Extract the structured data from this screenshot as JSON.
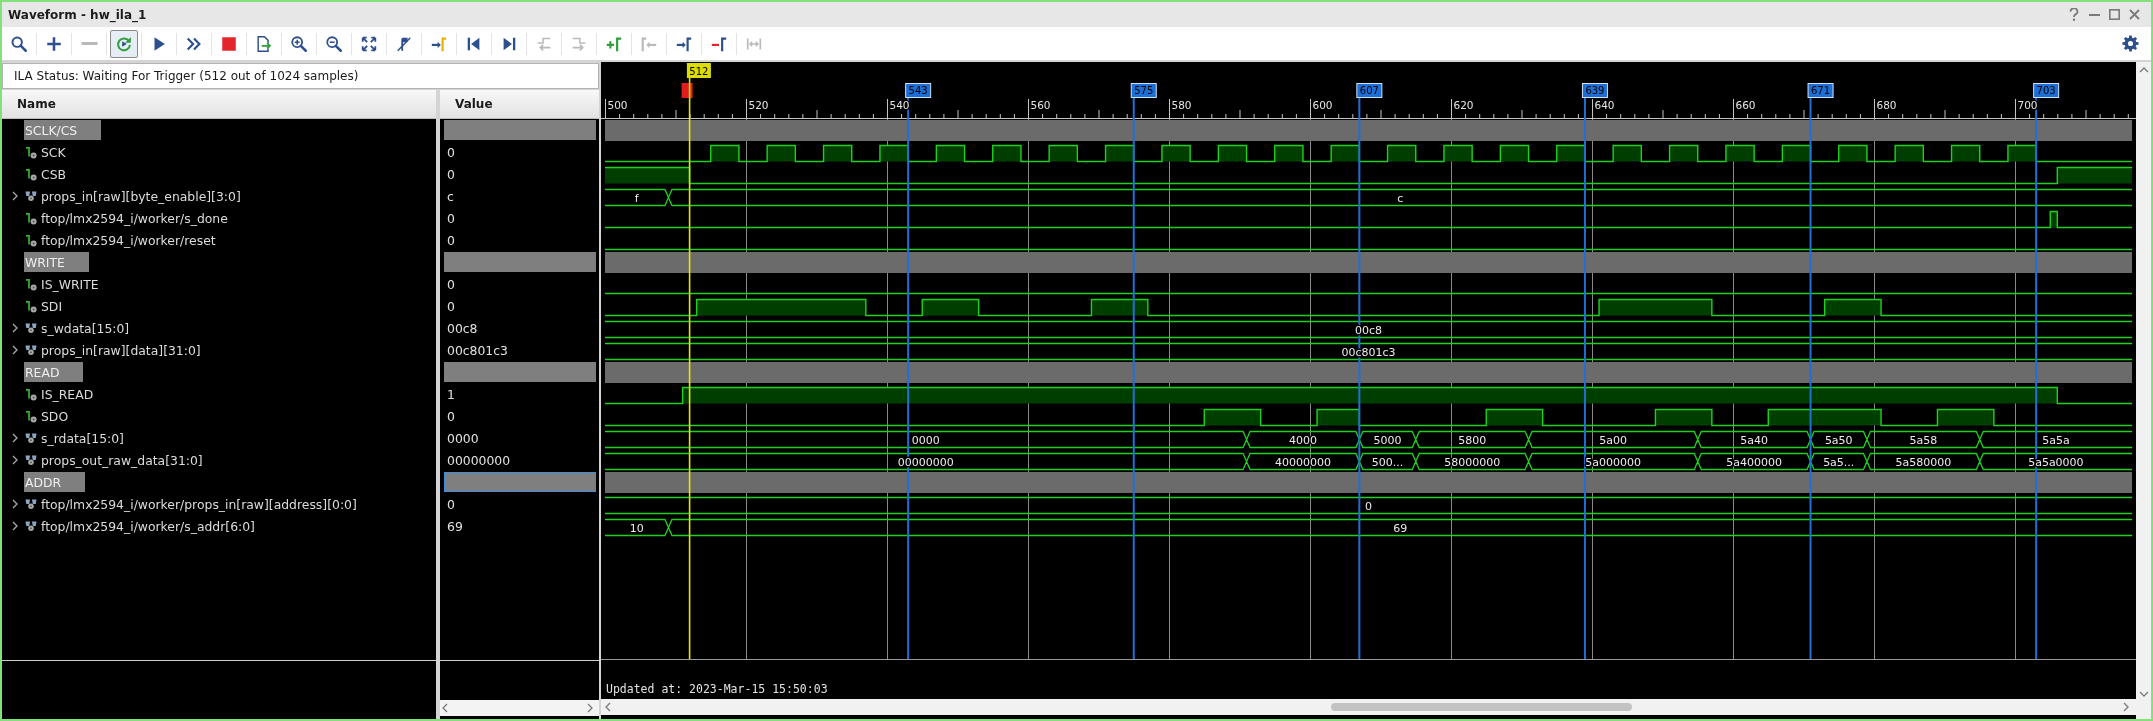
{
  "window": {
    "title": "Waveform - hw_ila_1"
  },
  "toolbar": [
    {
      "selected": false,
      "disabled": false
    },
    {
      "selected": false,
      "disabled": false
    },
    {
      "selected": false,
      "disabled": true
    },
    {
      "selected": true,
      "disabled": false
    },
    {
      "selected": false,
      "disabled": false
    },
    {
      "selected": false,
      "disabled": false
    },
    {
      "selected": false,
      "disabled": false
    },
    {
      "selected": false,
      "disabled": false
    },
    {
      "selected": false,
      "disabled": false
    },
    {
      "selected": false,
      "disabled": false
    },
    {
      "selected": false,
      "disabled": false
    },
    {
      "selected": false,
      "disabled": false
    },
    {
      "selected": false,
      "disabled": false
    },
    {
      "selected": false,
      "disabled": false
    },
    {
      "selected": false,
      "disabled": false
    },
    {
      "selected": false,
      "disabled": true
    },
    {
      "selected": false,
      "disabled": true
    },
    {
      "selected": false,
      "disabled": false
    },
    {
      "selected": false,
      "disabled": true
    },
    {
      "selected": false,
      "disabled": false
    },
    {
      "selected": false,
      "disabled": false
    },
    {
      "selected": false,
      "disabled": true
    }
  ],
  "status": "ILA Status: Waiting For Trigger (512 out of 1024 samples)",
  "columns": [
    "Name",
    "Value"
  ],
  "signals": [
    {
      "kind": "group",
      "name": "SCLK/CS",
      "focused": false
    },
    {
      "kind": "bit",
      "name": "SCK",
      "value": "0",
      "focused": false
    },
    {
      "kind": "bit",
      "name": "CSB",
      "value": "0",
      "focused": false
    },
    {
      "kind": "bus",
      "name": "props_in[raw][byte_enable][3:0]",
      "value": "c",
      "expanded": false,
      "focused": false,
      "segments": [
        "f",
        "c"
      ]
    },
    {
      "kind": "bit",
      "name": "ftop/lmx2594_i/worker/s_done",
      "value": "0",
      "focused": false
    },
    {
      "kind": "bit",
      "name": "ftop/lmx2594_i/worker/reset",
      "value": "0",
      "focused": false
    },
    {
      "kind": "group",
      "name": "WRITE",
      "focused": false
    },
    {
      "kind": "bit",
      "name": "IS_WRITE",
      "value": "0",
      "focused": false
    },
    {
      "kind": "bit",
      "name": "SDI",
      "value": "0",
      "focused": false
    },
    {
      "kind": "bus",
      "name": "s_wdata[15:0]",
      "value": "00c8",
      "expanded": false,
      "focused": false,
      "segments": [
        "00c8"
      ]
    },
    {
      "kind": "bus",
      "name": "props_in[raw][data][31:0]",
      "value": "00c801c3",
      "expanded": false,
      "focused": false,
      "segments": [
        "00c801c3"
      ]
    },
    {
      "kind": "group",
      "name": "READ",
      "focused": false
    },
    {
      "kind": "bit",
      "name": "IS_READ",
      "value": "1",
      "focused": false
    },
    {
      "kind": "bit",
      "name": "SDO",
      "value": "0",
      "focused": false
    },
    {
      "kind": "bus",
      "name": "s_rdata[15:0]",
      "value": "0000",
      "expanded": false,
      "focused": false,
      "segments": [
        "0000",
        "4000",
        "5000",
        "5800",
        "5a00",
        "5a40",
        "5a50",
        "5a58",
        "5a5a"
      ]
    },
    {
      "kind": "bus",
      "name": "props_out_raw_data[31:0]",
      "value": "00000000",
      "expanded": false,
      "focused": false,
      "segments": [
        "00000000",
        "40000000",
        "500...",
        "58000000",
        "5a000000",
        "5a400000",
        "5a5...",
        "5a580000",
        "5a5a0000"
      ]
    },
    {
      "kind": "group",
      "name": "ADDR",
      "focused": true
    },
    {
      "kind": "bus",
      "name": "ftop/lmx2594_i/worker/props_in[raw][address][0:0]",
      "value": "0",
      "expanded": false,
      "focused": false,
      "segments": [
        "0"
      ]
    },
    {
      "kind": "bus",
      "name": "ftop/lmx2594_i/worker/s_addr[6:0]",
      "value": "69",
      "expanded": false,
      "focused": false,
      "segments": [
        "10",
        "69"
      ]
    }
  ],
  "ruler": {
    "ticks": [
      "500",
      "520",
      "540",
      "560",
      "580",
      "600",
      "620",
      "640",
      "660",
      "680",
      "700"
    ],
    "cursor": "512",
    "markers": [
      "543",
      "575",
      "607",
      "639",
      "671",
      "703"
    ]
  },
  "footer": {
    "updated": "Updated at: 2023-Mar-15 15:50:03"
  }
}
